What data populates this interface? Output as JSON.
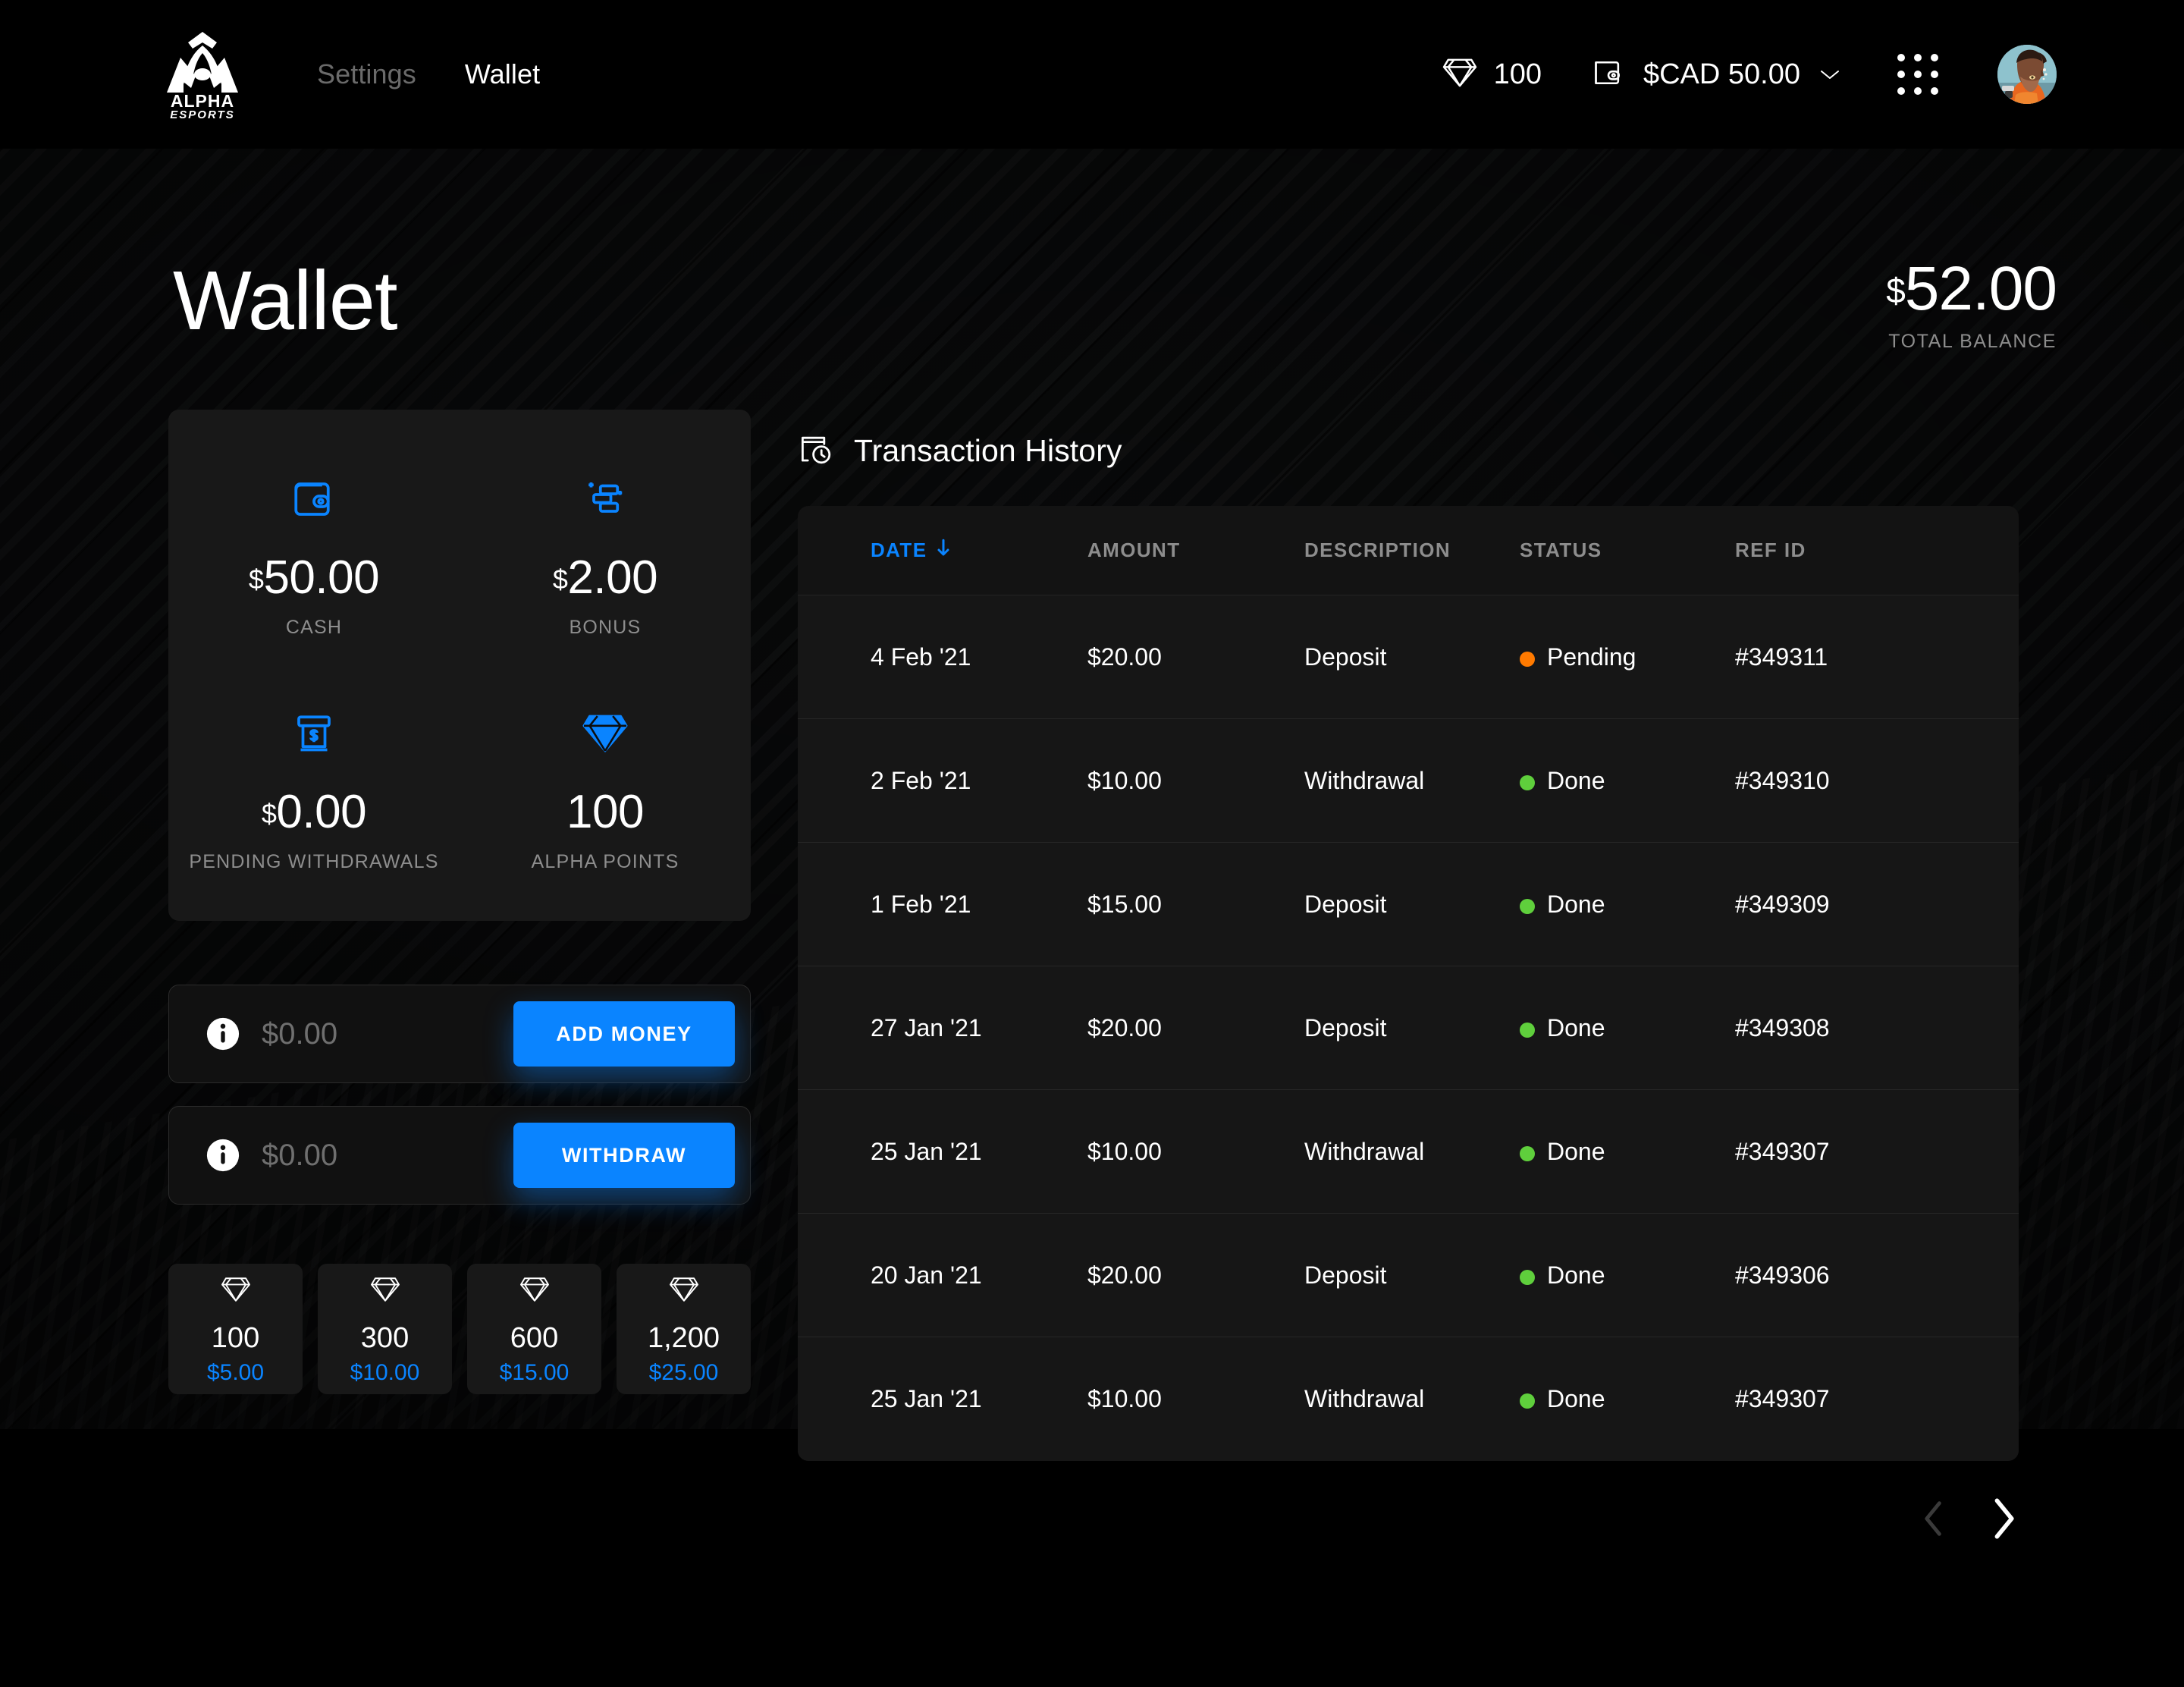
{
  "header": {
    "brand": {
      "name": "ALPHA",
      "sub": "ESPORTS"
    },
    "nav": [
      {
        "label": "Settings",
        "active": false
      },
      {
        "label": "Wallet",
        "active": true
      }
    ],
    "points_value": "100",
    "wallet_value": "$CAD 50.00",
    "icons": {
      "diamond": "diamond-icon",
      "wallet": "wallet-icon",
      "chevron": "chevron-down-icon",
      "apps": "grid-dots-icon",
      "avatar": "user-avatar"
    }
  },
  "hero": {
    "title": "Wallet",
    "balance_currency": "$",
    "balance_amount": "52.00",
    "balance_label": "TOTAL BALANCE"
  },
  "stats": [
    {
      "icon": "wallet-icon",
      "currency": "$",
      "value": "50.00",
      "label": "CASH"
    },
    {
      "icon": "coins-sparkle-icon",
      "currency": "$",
      "value": "2.00",
      "label": "BONUS"
    },
    {
      "icon": "atm-cash-icon",
      "currency": "$",
      "value": "0.00",
      "label": "PENDING WITHDRAWALS"
    },
    {
      "icon": "diamond-icon",
      "currency": "",
      "value": "100",
      "label": "ALPHA POINTS"
    }
  ],
  "money_actions": [
    {
      "icon": "info-icon",
      "value": "$0.00",
      "placeholder": "$0.00",
      "button": "ADD MONEY"
    },
    {
      "icon": "info-icon",
      "value": "$0.00",
      "placeholder": "$0.00",
      "button": "WITHDRAW"
    }
  ],
  "packs": [
    {
      "icon": "diamond-icon",
      "amount": "100",
      "price": "$5.00"
    },
    {
      "icon": "diamond-icon",
      "amount": "300",
      "price": "$10.00"
    },
    {
      "icon": "diamond-icon",
      "amount": "600",
      "price": "$15.00"
    },
    {
      "icon": "diamond-icon",
      "amount": "1,200",
      "price": "$25.00"
    }
  ],
  "transactions": {
    "title": "Transaction History",
    "title_icon": "transaction-history-icon",
    "sort_column": "DATE",
    "sort_direction": "desc",
    "columns": [
      "DATE",
      "AMOUNT",
      "DESCRIPTION",
      "STATUS",
      "REF ID"
    ],
    "rows": [
      {
        "date": "4 Feb '21",
        "amount": "$20.00",
        "description": "Deposit",
        "status": "Pending",
        "status_color": "#ff7a00",
        "ref": "#349311"
      },
      {
        "date": "2 Feb '21",
        "amount": "$10.00",
        "description": "Withdrawal",
        "status": "Done",
        "status_color": "#5fcf3c",
        "ref": "#349310"
      },
      {
        "date": "1 Feb '21",
        "amount": "$15.00",
        "description": "Deposit",
        "status": "Done",
        "status_color": "#5fcf3c",
        "ref": "#349309"
      },
      {
        "date": "27 Jan '21",
        "amount": "$20.00",
        "description": "Deposit",
        "status": "Done",
        "status_color": "#5fcf3c",
        "ref": "#349308"
      },
      {
        "date": "25 Jan '21",
        "amount": "$10.00",
        "description": "Withdrawal",
        "status": "Done",
        "status_color": "#5fcf3c",
        "ref": "#349307"
      },
      {
        "date": "20 Jan '21",
        "amount": "$20.00",
        "description": "Deposit",
        "status": "Done",
        "status_color": "#5fcf3c",
        "ref": "#349306"
      },
      {
        "date": "25 Jan '21",
        "amount": "$10.00",
        "description": "Withdrawal",
        "status": "Done",
        "status_color": "#5fcf3c",
        "ref": "#349307"
      }
    ]
  },
  "pagination": {
    "prev_icon": "chevron-left-icon",
    "next_icon": "chevron-right-icon",
    "prev_enabled": false,
    "next_enabled": true
  },
  "colors": {
    "accent": "#0a84ff",
    "pending": "#ff7a00",
    "done": "#5fcf3c",
    "card": "#181818",
    "page_bg": "#000000"
  }
}
